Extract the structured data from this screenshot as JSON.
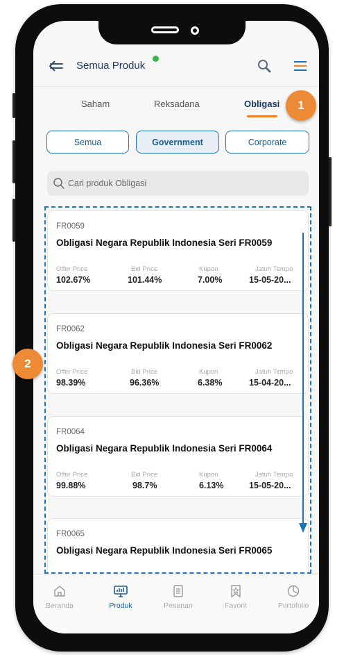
{
  "header": {
    "title": "Semua Produk",
    "status_color": "#38b54a"
  },
  "tabs": [
    {
      "label": "Saham"
    },
    {
      "label": "Reksadana"
    },
    {
      "label": "Obligasi",
      "active": true
    }
  ],
  "badges": {
    "tabs_badge": "1",
    "list_badge": "2"
  },
  "filters": [
    {
      "label": "Semua"
    },
    {
      "label": "Government",
      "active": true
    },
    {
      "label": "Corporate"
    }
  ],
  "search": {
    "placeholder": "Cari produk Obligasi",
    "value": ""
  },
  "columns": {
    "offer": "Offer Price",
    "bid": "Bid Price",
    "kupon": "Kupon",
    "tempo": "Jatuh Tempo"
  },
  "cards": [
    {
      "code": "FR0059",
      "name": "Obligasi Negara Republik Indonesia Seri FR0059",
      "offer": "102.67%",
      "bid": "101.44%",
      "kupon": "7.00%",
      "tempo": "15-05-20..."
    },
    {
      "code": "FR0062",
      "name": "Obligasi Negara Republik Indonesia Seri FR0062",
      "offer": "98.39%",
      "bid": "96.36%",
      "kupon": "6.38%",
      "tempo": "15-04-20..."
    },
    {
      "code": "FR0064",
      "name": "Obligasi Negara Republik Indonesia Seri FR0064",
      "offer": "99.88%",
      "bid": "98.7%",
      "kupon": "6.13%",
      "tempo": "15-05-20..."
    },
    {
      "code": "FR0065",
      "name": "Obligasi Negara Republik Indonesia Seri FR0065"
    }
  ],
  "nav": [
    {
      "label": "Beranda",
      "icon": "home-icon"
    },
    {
      "label": "Produk",
      "icon": "products-icon",
      "active": true
    },
    {
      "label": "Pesanan",
      "icon": "orders-icon"
    },
    {
      "label": "Favorit",
      "icon": "favorite-icon"
    },
    {
      "label": "Portofolio",
      "icon": "portfolio-icon"
    }
  ],
  "colors": {
    "accent": "#1e74b8",
    "badge": "#ec8a35",
    "tab_underline": "#f0822c",
    "title": "#1f3b5c"
  }
}
